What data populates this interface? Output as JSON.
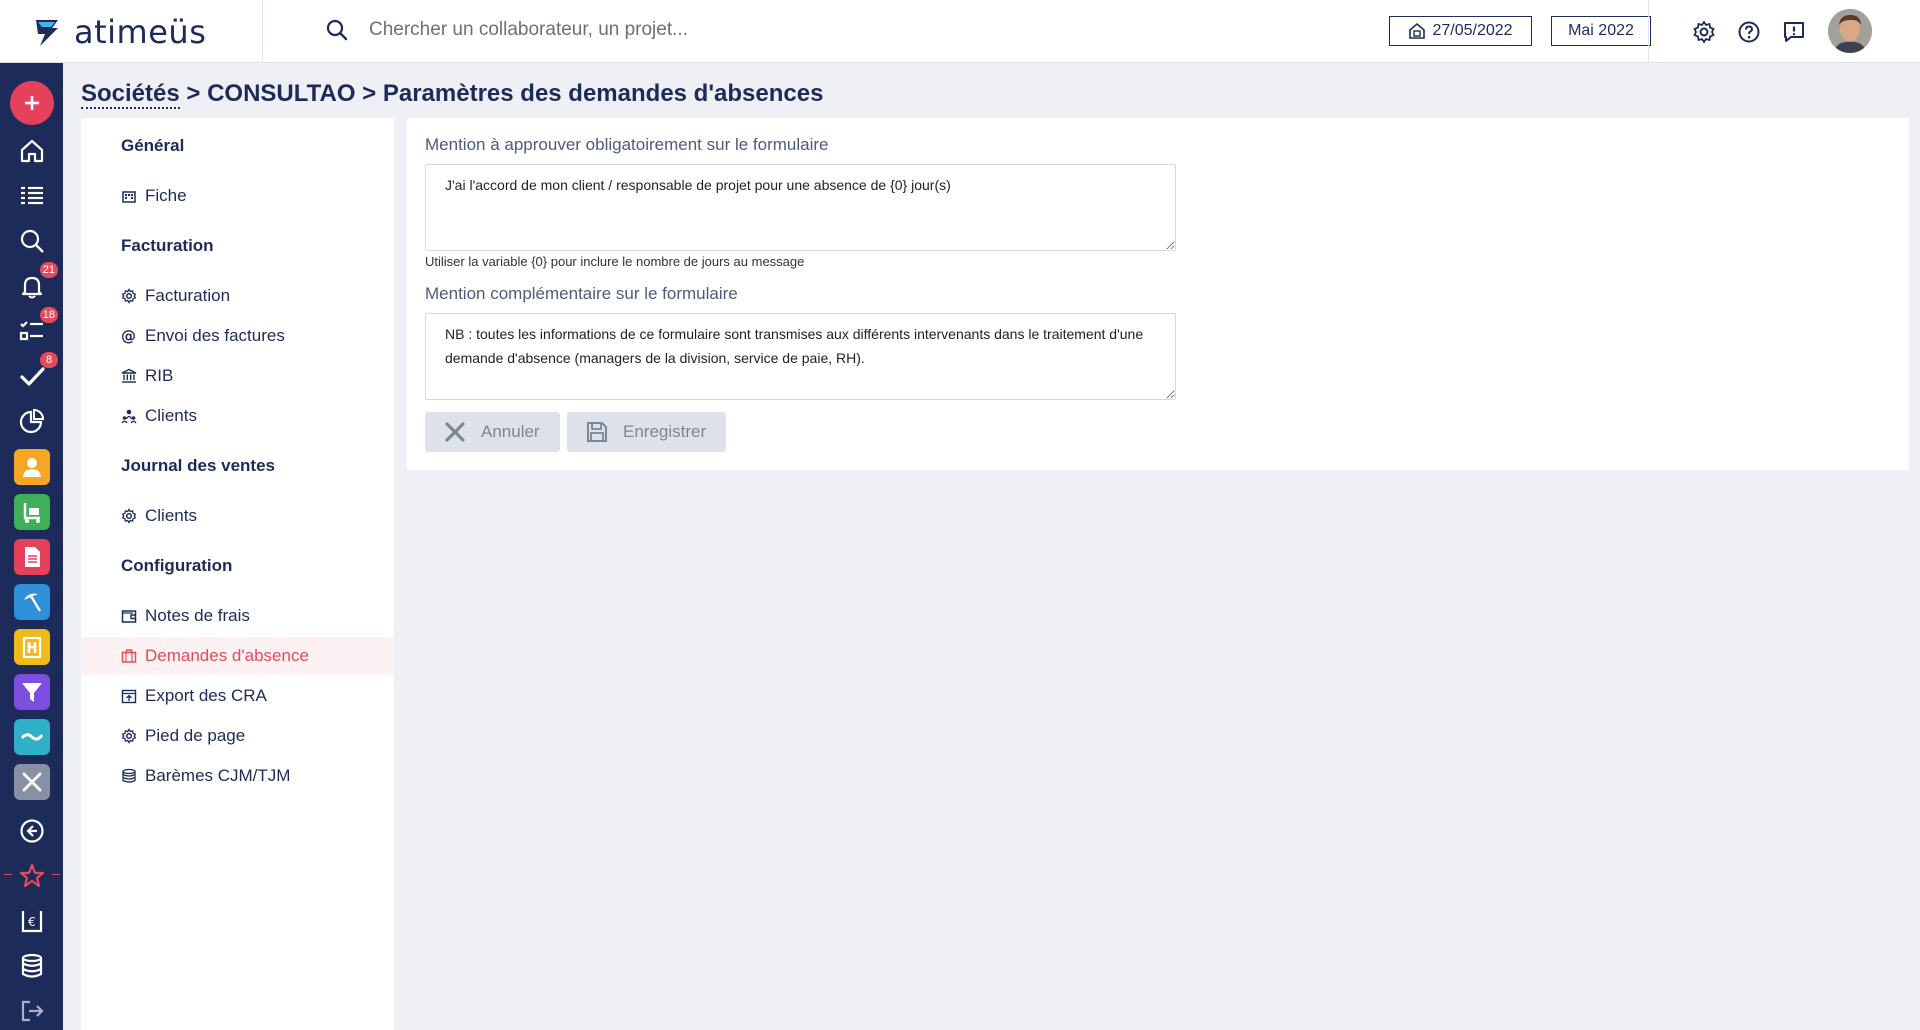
{
  "header": {
    "logo_text": "atimeüs",
    "search_placeholder": "Chercher un collaborateur, un projet...",
    "date": "27/05/2022",
    "period": "Mai 2022"
  },
  "rail": {
    "badges": {
      "notifications": "21",
      "tasks": "18",
      "validations": "8"
    }
  },
  "breadcrumb": {
    "root": "Sociétés",
    "rest": " > CONSULTAO > Paramètres des demandes d'absences"
  },
  "subnav": {
    "sections": [
      {
        "title": "Général",
        "items": [
          {
            "label": "Fiche",
            "icon": "building-icon"
          }
        ]
      },
      {
        "title": "Facturation",
        "items": [
          {
            "label": "Facturation",
            "icon": "gear-icon"
          },
          {
            "label": "Envoi des factures",
            "icon": "at-icon"
          },
          {
            "label": "RIB",
            "icon": "bank-icon"
          },
          {
            "label": "Clients",
            "icon": "people-icon"
          }
        ]
      },
      {
        "title": "Journal des ventes",
        "items": [
          {
            "label": "Clients",
            "icon": "gear-icon"
          }
        ]
      },
      {
        "title": "Configuration",
        "items": [
          {
            "label": "Notes de frais",
            "icon": "wallet-icon"
          },
          {
            "label": "Demandes d'absence",
            "icon": "suitcase-icon",
            "active": true
          },
          {
            "label": "Export des CRA",
            "icon": "calendar-export-icon"
          },
          {
            "label": "Pied de page",
            "icon": "gear-icon"
          },
          {
            "label": "Barèmes CJM/TJM",
            "icon": "database-icon"
          }
        ]
      }
    ]
  },
  "form": {
    "field1_label": "Mention à approuver obligatoirement sur le formulaire",
    "field1_value": "J'ai l'accord de mon client / responsable de projet pour une absence de {0} jour(s)",
    "field1_help": "Utiliser la variable {0} pour inclure le nombre de jours au message",
    "field2_label": "Mention complémentaire sur le formulaire",
    "field2_value": "NB : toutes les informations de ce formulaire sont transmises aux différents intervenants dans le traitement d'une demande d'absence (managers de la division, service de paie, RH).",
    "cancel_label": "Annuler",
    "save_label": "Enregistrer"
  },
  "colors": {
    "navy": "#1d2b5a",
    "accent": "#e64b5a",
    "background": "#eef0f6"
  }
}
